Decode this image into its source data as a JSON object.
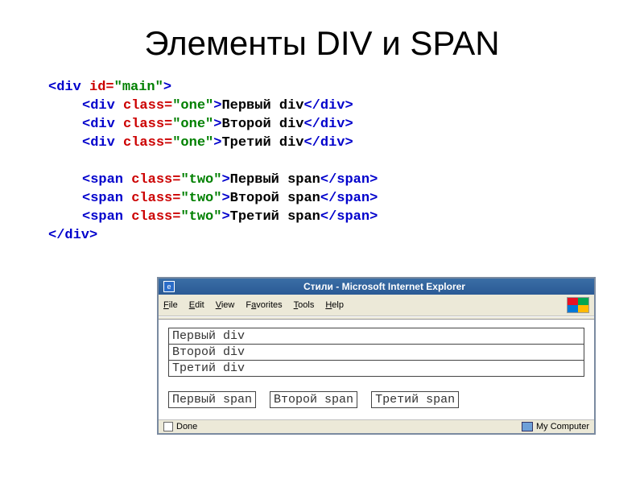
{
  "title": "Элементы DIV и SPAN",
  "code": {
    "l1_open": "<div",
    "l1_attr": " id=",
    "l1_val": "\"main\"",
    "l1_close": ">",
    "inner_open": "<div",
    "inner_attr": " class=",
    "inner_val_one": "\"one\"",
    "inner_close_gt": ">",
    "inner_end": "</div>",
    "t1": "Первый div",
    "t2": "Второй div",
    "t3": "Третий div",
    "span_open": "<span",
    "span_val_two": "\"two\"",
    "span_end": "</span>",
    "s1": "Первый span",
    "s2": "Второй span",
    "s3": "Третий span",
    "close_div": "</div>"
  },
  "browser": {
    "title": "Стили - Microsoft Internet Explorer",
    "menu": {
      "file": "File",
      "edit": "Edit",
      "view": "View",
      "favorites": "Favorites",
      "tools": "Tools",
      "help": "Help"
    },
    "content": {
      "div1": "Первый div",
      "div2": "Второй div",
      "div3": "Третий div",
      "span1": "Первый span",
      "span2": "Второй span",
      "span3": "Третий span"
    },
    "status_left": "Done",
    "status_right": "My Computer"
  }
}
